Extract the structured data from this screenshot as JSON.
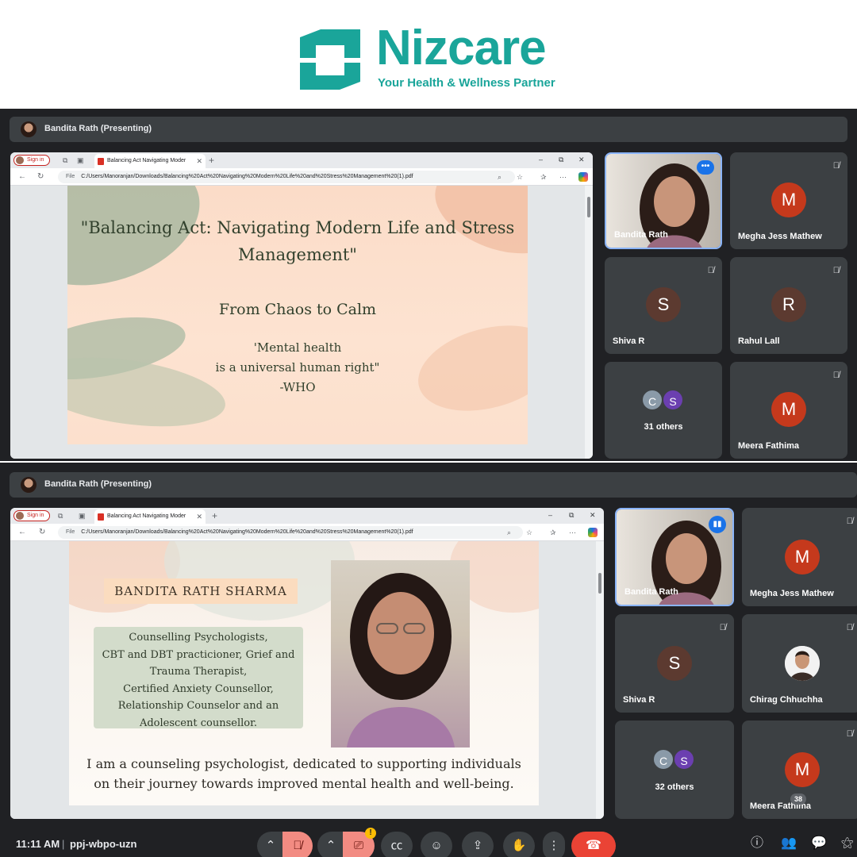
{
  "brand": {
    "name": "Nizcare",
    "tagline": "Your Health & Wellness Partner",
    "color": "#1aa59a"
  },
  "meet": {
    "presenting_label": "Bandita Rath (Presenting)",
    "time": "11:11 AM",
    "separator": "|",
    "meeting_code": "ppj-wbpo-uzn",
    "people_count": "38",
    "warning_mark": "!"
  },
  "browser": {
    "signin_label": "Sign in",
    "tab_title": "Balancing Act Navigating Moder",
    "file_label": "File",
    "url": "C:/Users/Manoranjan/Downloads/Balancing%20Act%20Navigating%20Modern%20Life%20and%20Stress%20Management%20(1).pdf"
  },
  "slide1": {
    "title_line1": "\"Balancing Act: Navigating Modern Life and Stress",
    "title_line2": "Management\"",
    "subtitle": "From Chaos to Calm",
    "quote_line1": "'Mental health",
    "quote_line2": "is a universal human right\"",
    "quote_author": "-WHO"
  },
  "slide2": {
    "name": "BANDITA RATH SHARMA",
    "credentials": [
      "Counselling Psychologists,",
      "CBT and DBT practicioner, Grief and",
      "Trauma Therapist,",
      "Certified Anxiety Counsellor,",
      "Relationship Counselor and an",
      "Adolescent counsellor."
    ],
    "intro_line1": "I am a counseling psychologist, dedicated to supporting individuals",
    "intro_line2": "on their journey towards improved mental health and well-being."
  },
  "participants_top": {
    "p1": "Bandita Rath",
    "p2": "Megha Jess Mathew",
    "p3": "Shiva R",
    "p4": "Rahul Lall",
    "p5": "31 others",
    "p6": "Meera Fathima"
  },
  "participants_bottom": {
    "p1": "Bandita Rath",
    "p2": "Megha Jess Mathew",
    "p3": "Shiva R",
    "p4": "Chirag Chhuchha",
    "p5": "32 others",
    "p6": "Meera Fathima"
  },
  "avatar_letters": {
    "m": "M",
    "s": "S",
    "r": "R",
    "c": "C"
  }
}
